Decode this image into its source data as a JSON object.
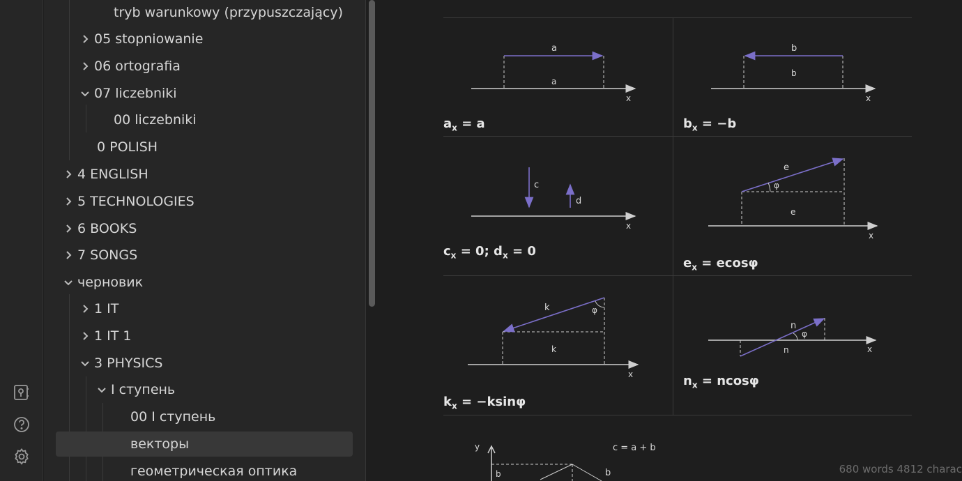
{
  "sidebar": {
    "items": [
      {
        "label": "tryb warunkowy (przypuszczający)",
        "expanded": null
      },
      {
        "label": "05 stopniowanie",
        "expanded": false
      },
      {
        "label": "06 ortografia",
        "expanded": false
      },
      {
        "label": "07 liczebniki",
        "expanded": true
      },
      {
        "label": "00 liczebniki",
        "expanded": null
      },
      {
        "label": "0 POLISH",
        "expanded": null
      },
      {
        "label": "4 ENGLISH",
        "expanded": false
      },
      {
        "label": "5 TECHNOLOGIES",
        "expanded": false
      },
      {
        "label": "6 BOOKS",
        "expanded": false
      },
      {
        "label": "7 SONGS",
        "expanded": false
      },
      {
        "label": "черновик",
        "expanded": true
      },
      {
        "label": "1 IT",
        "expanded": false
      },
      {
        "label": "1 IT 1",
        "expanded": false
      },
      {
        "label": "3 PHYSICS",
        "expanded": true
      },
      {
        "label": "I ступень",
        "expanded": true
      },
      {
        "label": "00 I ступень",
        "expanded": null
      },
      {
        "label": "векторы",
        "expanded": null,
        "active": true
      },
      {
        "label": "геометрическая оптика",
        "expanded": null
      }
    ]
  },
  "ribbon": {
    "icons": [
      "vault-icon",
      "help-icon",
      "settings-icon"
    ]
  },
  "content": {
    "formulas": {
      "a": {
        "var": "a",
        "sub": "x",
        "rhs": "= a"
      },
      "b": {
        "var": "b",
        "sub": "x",
        "rhs": "= −b"
      },
      "cd": {
        "var1": "c",
        "sub1": "x",
        "mid": "= 0; d",
        "sub2": "x",
        "rhs": "= 0"
      },
      "e": {
        "var": "e",
        "sub": "x",
        "rhs": "= ecosφ"
      },
      "k": {
        "var": "k",
        "sub": "x",
        "rhs": "= −ksinφ"
      },
      "n": {
        "var": "n",
        "sub": "x",
        "rhs": "= ncosφ"
      }
    },
    "diagram_labels": {
      "a_vec": "a",
      "a_proj": "a",
      "b_vec": "b",
      "b_proj": "b",
      "c_vec": "c",
      "d_vec": "d",
      "e_vec": "e",
      "e_proj": "e",
      "k_vec": "k",
      "k_proj": "k",
      "n_vec": "n",
      "n_proj": "n",
      "phi": "φ",
      "x_axis": "x",
      "y_axis": "y",
      "sub_x": "x",
      "sum": "c = a + b",
      "b_bottom": "b"
    }
  },
  "status": {
    "text": "680 words 4812 charac"
  },
  "colors": {
    "accent_vector": "#7b6fc9",
    "axis": "#cfcfcf",
    "background": "#1e1e1e",
    "sidebar_bg": "#262626"
  }
}
